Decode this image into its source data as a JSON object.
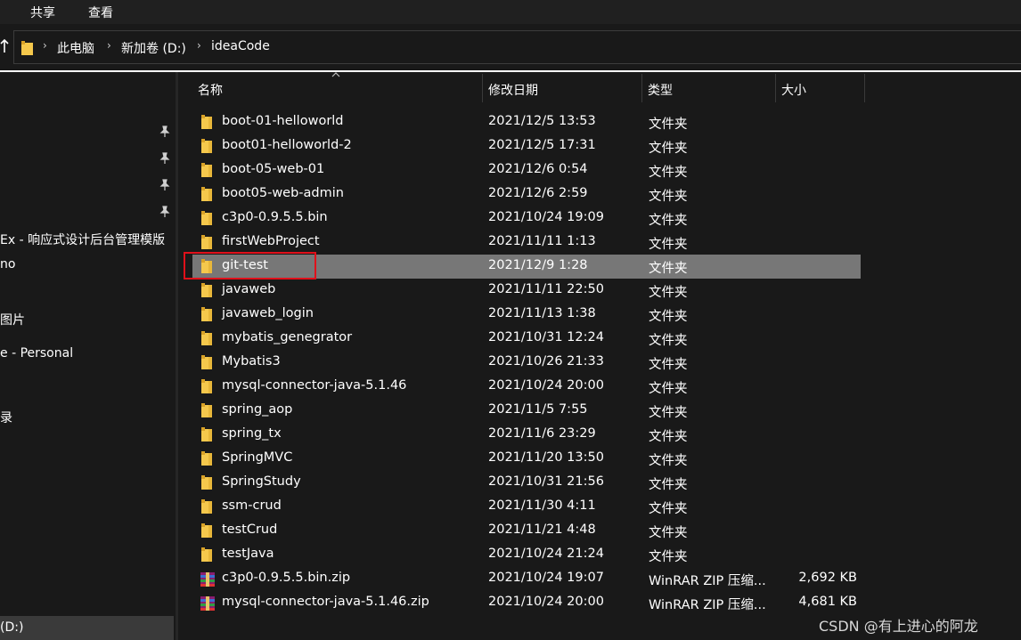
{
  "ribbon": {
    "tabs": [
      "共享",
      "查看"
    ]
  },
  "address": {
    "crumbs": [
      "此电脑",
      "新加卷 (D:)",
      "ideaCode"
    ]
  },
  "nav": {
    "items": [
      "Ex - 响应式设计后台管理模版",
      "no",
      "图片",
      "e - Personal",
      "录"
    ],
    "bottom": "(D:)"
  },
  "columns": {
    "name": "名称",
    "date": "修改日期",
    "type": "类型",
    "size": "大小"
  },
  "files": [
    {
      "icon": "folder-icon",
      "name": "boot-01-helloworld",
      "date": "2021/12/5 13:53",
      "type": "文件夹",
      "size": ""
    },
    {
      "icon": "folder-icon",
      "name": "boot01-helloworld-2",
      "date": "2021/12/5 17:31",
      "type": "文件夹",
      "size": ""
    },
    {
      "icon": "folder-icon",
      "name": "boot-05-web-01",
      "date": "2021/12/6 0:54",
      "type": "文件夹",
      "size": ""
    },
    {
      "icon": "folder-icon",
      "name": "boot05-web-admin",
      "date": "2021/12/6 2:59",
      "type": "文件夹",
      "size": ""
    },
    {
      "icon": "folder-icon",
      "name": "c3p0-0.9.5.5.bin",
      "date": "2021/10/24 19:09",
      "type": "文件夹",
      "size": ""
    },
    {
      "icon": "folder-icon",
      "name": "firstWebProject",
      "date": "2021/11/11 1:13",
      "type": "文件夹",
      "size": ""
    },
    {
      "icon": "folder-icon",
      "name": "git-test",
      "date": "2021/12/9 1:28",
      "type": "文件夹",
      "size": ""
    },
    {
      "icon": "folder-icon",
      "name": "javaweb",
      "date": "2021/11/11 22:50",
      "type": "文件夹",
      "size": ""
    },
    {
      "icon": "folder-icon",
      "name": "javaweb_login",
      "date": "2021/11/13 1:38",
      "type": "文件夹",
      "size": ""
    },
    {
      "icon": "folder-icon",
      "name": "mybatis_genegrator",
      "date": "2021/10/31 12:24",
      "type": "文件夹",
      "size": ""
    },
    {
      "icon": "folder-icon",
      "name": "Mybatis3",
      "date": "2021/10/26 21:33",
      "type": "文件夹",
      "size": ""
    },
    {
      "icon": "folder-icon",
      "name": "mysql-connector-java-5.1.46",
      "date": "2021/10/24 20:00",
      "type": "文件夹",
      "size": ""
    },
    {
      "icon": "folder-icon",
      "name": "spring_aop",
      "date": "2021/11/5 7:55",
      "type": "文件夹",
      "size": ""
    },
    {
      "icon": "folder-icon",
      "name": "spring_tx",
      "date": "2021/11/6 23:29",
      "type": "文件夹",
      "size": ""
    },
    {
      "icon": "folder-icon",
      "name": "SpringMVC",
      "date": "2021/11/20 13:50",
      "type": "文件夹",
      "size": ""
    },
    {
      "icon": "folder-icon",
      "name": "SpringStudy",
      "date": "2021/10/31 21:56",
      "type": "文件夹",
      "size": ""
    },
    {
      "icon": "folder-icon",
      "name": "ssm-crud",
      "date": "2021/11/30 4:11",
      "type": "文件夹",
      "size": ""
    },
    {
      "icon": "folder-icon",
      "name": "testCrud",
      "date": "2021/11/21 4:48",
      "type": "文件夹",
      "size": ""
    },
    {
      "icon": "folder-icon",
      "name": "testJava",
      "date": "2021/10/24 21:24",
      "type": "文件夹",
      "size": ""
    },
    {
      "icon": "winrar-zip-icon",
      "name": "c3p0-0.9.5.5.bin.zip",
      "date": "2021/10/24 19:07",
      "type": "WinRAR ZIP 压缩...",
      "size": "2,692 KB"
    },
    {
      "icon": "winrar-zip-icon",
      "name": "mysql-connector-java-5.1.46.zip",
      "date": "2021/10/24 20:00",
      "type": "WinRAR ZIP 压缩...",
      "size": "4,681 KB"
    }
  ],
  "selected_file": "git-test",
  "watermark": "CSDN @有上进心的阿龙",
  "colors": {
    "background": "#191919",
    "selection": "#777777",
    "highlight_border": "#e0101a",
    "folder": "#f5c84c"
  }
}
